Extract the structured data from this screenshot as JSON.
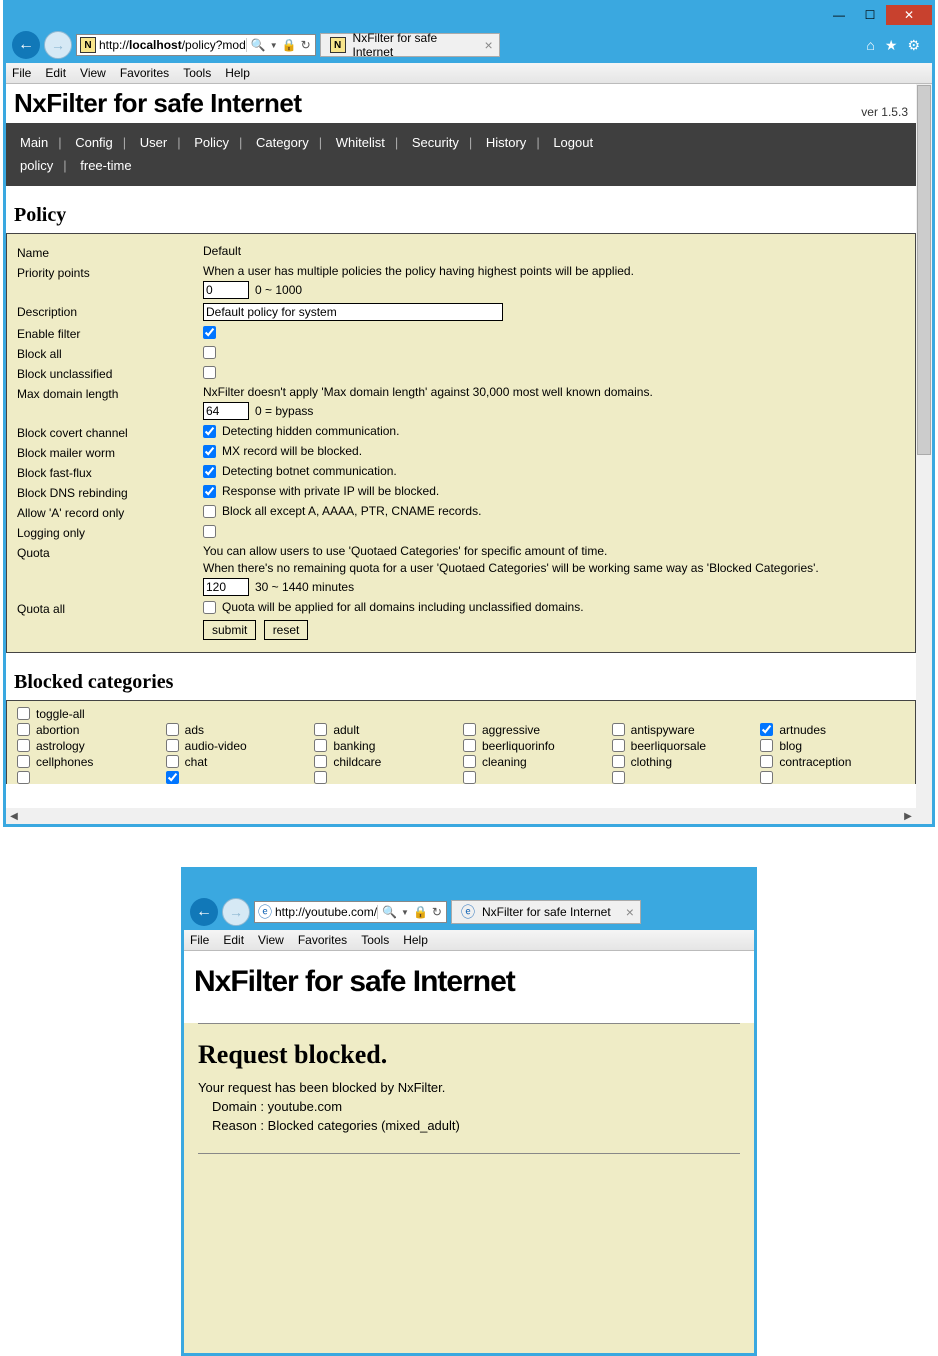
{
  "window1": {
    "url_display": "http://localhost/policy?mod",
    "url_host": "localhost",
    "tab_title": "NxFilter for safe Internet",
    "menus": [
      "File",
      "Edit",
      "View",
      "Favorites",
      "Tools",
      "Help"
    ]
  },
  "app": {
    "title": "NxFilter for safe Internet",
    "version": "ver 1.5.3",
    "nav": [
      "Main",
      "Config",
      "User",
      "Policy",
      "Category",
      "Whitelist",
      "Security",
      "History",
      "Logout"
    ],
    "breadcrumb": [
      "policy",
      "free-time"
    ]
  },
  "policy": {
    "title": "Policy",
    "name_label": "Name",
    "name_value": "Default",
    "priority_label": "Priority points",
    "priority_help": "When a user has multiple policies the policy having highest points will be applied.",
    "priority_value": "0",
    "priority_range": "0 ~ 1000",
    "description_label": "Description",
    "description_value": "Default policy for system",
    "enable_filter_label": "Enable filter",
    "enable_filter_checked": true,
    "block_all_label": "Block all",
    "block_all_checked": false,
    "block_unclassified_label": "Block unclassified",
    "block_unclassified_checked": false,
    "max_domain_label": "Max domain length",
    "max_domain_help": "NxFilter doesn't apply 'Max domain length' against 30,000 most well known domains.",
    "max_domain_value": "64",
    "max_domain_note": "0 = bypass",
    "block_covert_label": "Block covert channel",
    "block_covert_checked": true,
    "block_covert_desc": "Detecting hidden communication.",
    "block_mailer_label": "Block mailer worm",
    "block_mailer_checked": true,
    "block_mailer_desc": "MX record will be blocked.",
    "block_fastflux_label": "Block fast-flux",
    "block_fastflux_checked": true,
    "block_fastflux_desc": "Detecting botnet communication.",
    "block_dnsrebind_label": "Block DNS rebinding",
    "block_dnsrebind_checked": true,
    "block_dnsrebind_desc": "Response with private IP will be blocked.",
    "allow_a_label": "Allow 'A' record only",
    "allow_a_checked": false,
    "allow_a_desc": "Block all except A, AAAA, PTR, CNAME records.",
    "logging_only_label": "Logging only",
    "logging_only_checked": false,
    "quota_label": "Quota",
    "quota_help1": "You can allow users to use 'Quotaed Categories' for specific amount of time.",
    "quota_help2": "When there's no remaining quota for a user 'Quotaed Categories' will be working same way as 'Blocked Categories'.",
    "quota_value": "120",
    "quota_range": "30 ~ 1440 minutes",
    "quota_all_label": "Quota all",
    "quota_all_checked": false,
    "quota_all_desc": "Quota will be applied for all domains including unclassified domains.",
    "submit_label": "submit",
    "reset_label": "reset"
  },
  "blocked_categories": {
    "title": "Blocked categories",
    "toggle_all": "toggle-all",
    "items": [
      {
        "label": "abortion",
        "checked": false
      },
      {
        "label": "ads",
        "checked": false
      },
      {
        "label": "adult",
        "checked": false
      },
      {
        "label": "aggressive",
        "checked": false
      },
      {
        "label": "antispyware",
        "checked": false
      },
      {
        "label": "artnudes",
        "checked": true
      },
      {
        "label": "astrology",
        "checked": false
      },
      {
        "label": "audio-video",
        "checked": false
      },
      {
        "label": "banking",
        "checked": false
      },
      {
        "label": "beerliquorinfo",
        "checked": false
      },
      {
        "label": "beerliquorsale",
        "checked": false
      },
      {
        "label": "blog",
        "checked": false
      },
      {
        "label": "cellphones",
        "checked": false
      },
      {
        "label": "chat",
        "checked": false
      },
      {
        "label": "childcare",
        "checked": false
      },
      {
        "label": "cleaning",
        "checked": false
      },
      {
        "label": "clothing",
        "checked": false
      },
      {
        "label": "contraception",
        "checked": false
      }
    ]
  },
  "window2": {
    "url_display": "http://youtube.com/",
    "tab_title": "NxFilter for safe Internet",
    "menus": [
      "File",
      "Edit",
      "View",
      "Favorites",
      "Tools",
      "Help"
    ],
    "page_title": "NxFilter for safe Internet",
    "blocked_heading": "Request blocked.",
    "blocked_msg": "Your request has been blocked by NxFilter.",
    "domain_line": "Domain : youtube.com",
    "reason_line": "Reason : Blocked categories (mixed_adult)"
  }
}
